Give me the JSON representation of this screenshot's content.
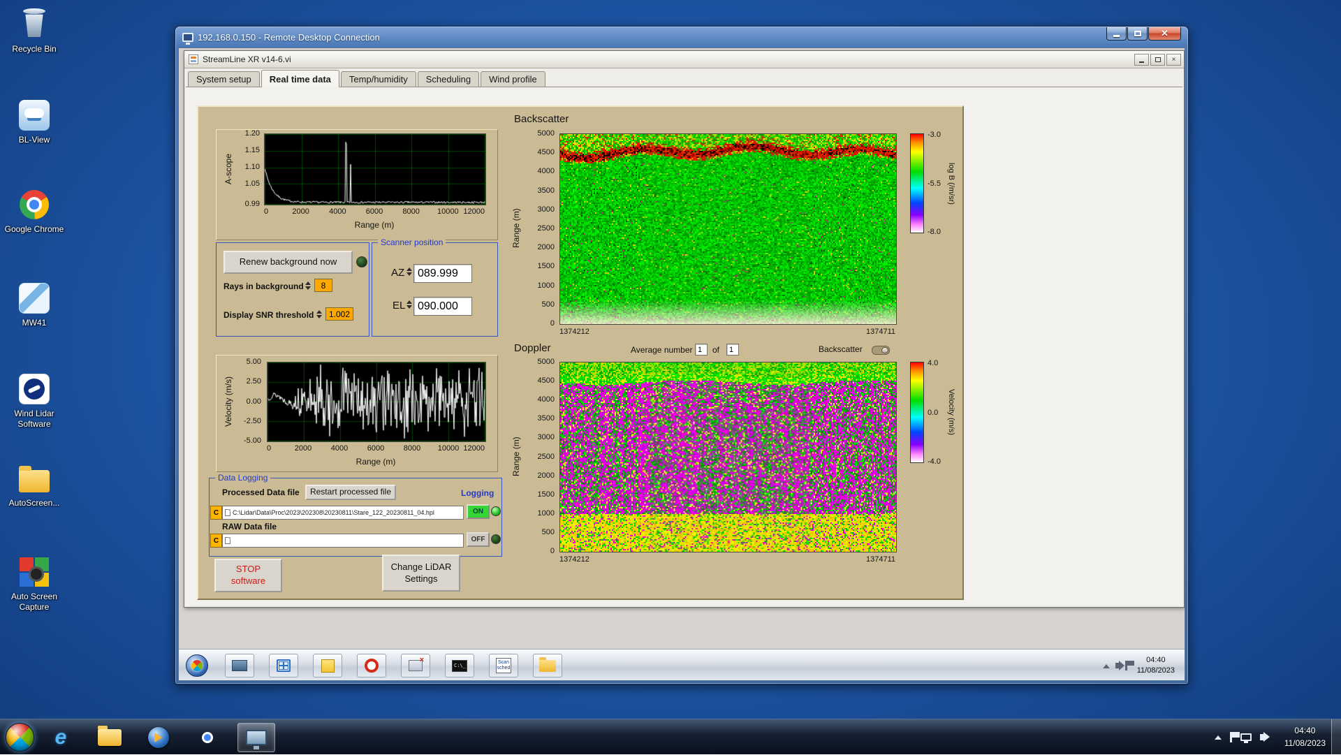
{
  "desktop": {
    "icons": [
      {
        "label": "Recycle Bin"
      },
      {
        "label": "BL-View"
      },
      {
        "label": "Google Chrome"
      },
      {
        "label": "MW41"
      },
      {
        "label": "Wind Lidar Software"
      },
      {
        "label": "AutoScreen..."
      },
      {
        "label": "Auto Screen Capture"
      }
    ]
  },
  "rdp_window": {
    "title": "192.168.0.150 - Remote Desktop Connection"
  },
  "app_window": {
    "title": "StreamLine XR v14-6.vi",
    "tabs": [
      {
        "label": "System setup"
      },
      {
        "label": "Real time data"
      },
      {
        "label": "Temp/humidity"
      },
      {
        "label": "Scheduling"
      },
      {
        "label": "Wind profile"
      }
    ]
  },
  "ascope": {
    "ylabel": "A-scope",
    "xlabel": "Range (m)",
    "yticks": [
      "1.20",
      "1.15",
      "1.10",
      "1.05",
      "0.99"
    ],
    "xticks": [
      "0",
      "2000",
      "4000",
      "6000",
      "8000",
      "10000",
      "12000"
    ]
  },
  "velocity_graph": {
    "ylabel": "Velocity (m/s)",
    "xlabel": "Range (m)",
    "yticks": [
      "5.00",
      "2.50",
      "0.00",
      "-2.50",
      "-5.00"
    ],
    "xticks": [
      "0",
      "2000",
      "4000",
      "6000",
      "8000",
      "10000",
      "12000"
    ]
  },
  "backscatter": {
    "title": "Backscatter",
    "ylabel": "Range (m)",
    "yticks": [
      "5000",
      "4500",
      "4000",
      "3500",
      "3000",
      "2500",
      "2000",
      "1500",
      "1000",
      "500",
      "0"
    ],
    "xticks": [
      "1374212",
      "1374711"
    ],
    "colorbar_ticks": [
      "-3.0",
      "-5.5",
      "-8.0"
    ],
    "colorbar_label": "log B (/m/sr)"
  },
  "doppler": {
    "title": "Doppler",
    "ylabel": "Range (m)",
    "yticks": [
      "5000",
      "4500",
      "4000",
      "3500",
      "3000",
      "2500",
      "2000",
      "1500",
      "1000",
      "500",
      "0"
    ],
    "xticks": [
      "1374212",
      "1374711"
    ],
    "colorbar_ticks": [
      "4.0",
      "0.0",
      "-4.0"
    ],
    "colorbar_label": "Velocity (m/s)",
    "average_label": "Average number",
    "average_value": "1",
    "of_label": "of",
    "of_value": "1",
    "backscatter_toggle_label": "Backscatter"
  },
  "controls": {
    "renew_button": "Renew background now",
    "rays_label": "Rays in background",
    "rays_value": "8",
    "snr_label": "Display SNR threshold",
    "snr_value": "1.002",
    "scanner_group": "Scanner position",
    "az_label": "AZ",
    "az_value": "089.999",
    "el_label": "EL",
    "el_value": "090.000"
  },
  "data_logging": {
    "group_title": "Data Logging",
    "processed_label": "Processed Data file",
    "restart_button": "Restart processed file",
    "logging_label": "Logging",
    "drive_letter": "C",
    "processed_path": "C:\\Lidar\\Data\\Proc\\2023\\202308\\20230811\\Stare_122_20230811_04.hpl",
    "raw_label": "RAW Data file",
    "raw_path": "",
    "on_label": "ON",
    "off_label": "OFF"
  },
  "actions": {
    "stop_line1": "STOP",
    "stop_line2": "software",
    "change_line1": "Change LiDAR",
    "change_line2": "Settings"
  },
  "remote_taskbar": {
    "cmd_glyph": "C:\\_",
    "scan_icon_line1": "Scan",
    "scan_icon_line2": "sched",
    "time": "04:40",
    "date": "11/08/2023"
  },
  "host_taskbar": {
    "time": "04:40",
    "date": "11/08/2023"
  }
}
